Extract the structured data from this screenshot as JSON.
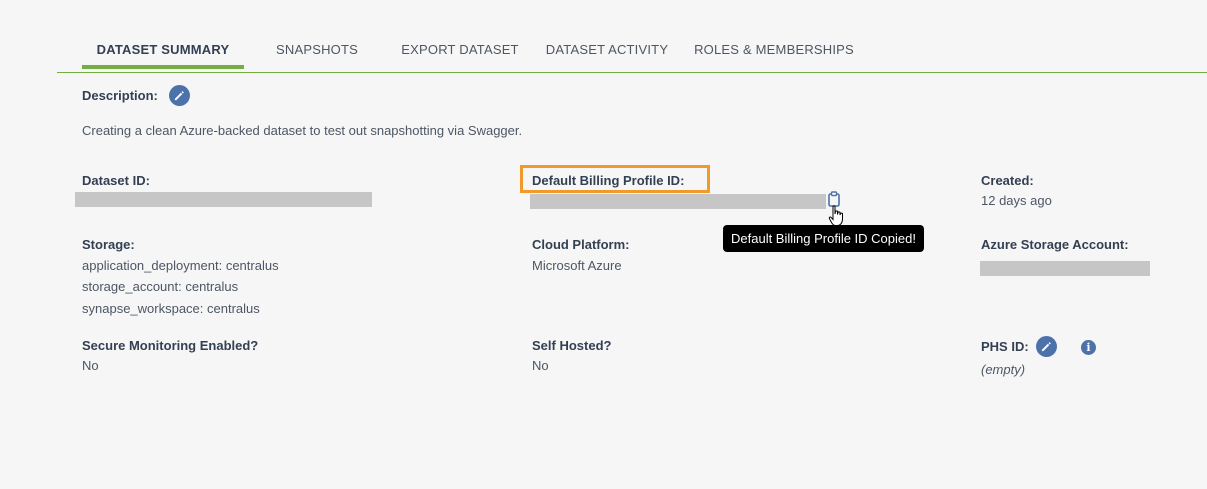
{
  "tabs": [
    {
      "label": "DATASET SUMMARY",
      "active": true
    },
    {
      "label": "SNAPSHOTS"
    },
    {
      "label": "EXPORT DATASET"
    },
    {
      "label": "DATASET ACTIVITY"
    },
    {
      "label": "ROLES & MEMBERSHIPS"
    }
  ],
  "description": {
    "label": "Description:",
    "text": "Creating a clean Azure-backed dataset to test out snapshotting via Swagger."
  },
  "dataset_id": {
    "label": "Dataset ID:"
  },
  "billing_profile": {
    "label": "Default Billing Profile ID:",
    "tooltip": "Default Billing Profile ID Copied!"
  },
  "created": {
    "label": "Created:",
    "value": "12 days ago"
  },
  "storage": {
    "label": "Storage:",
    "items": [
      "application_deployment: centralus",
      "storage_account: centralus",
      "synapse_workspace: centralus"
    ]
  },
  "cloud_platform": {
    "label": "Cloud Platform:",
    "value": "Microsoft Azure"
  },
  "azure_storage_account": {
    "label": "Azure Storage Account:"
  },
  "secure_monitoring": {
    "label": "Secure Monitoring Enabled?",
    "value": "No"
  },
  "self_hosted": {
    "label": "Self Hosted?",
    "value": "No"
  },
  "phs_id": {
    "label": "PHS ID:",
    "value": "(empty)"
  },
  "colors": {
    "accent": "#74ae43",
    "highlight": "#f19a2a",
    "icon": "#4d72aa"
  },
  "icons": {
    "edit": "pencil-icon",
    "info": "info-icon",
    "copy": "clipboard-icon",
    "cursor": "hand-pointer-icon"
  }
}
